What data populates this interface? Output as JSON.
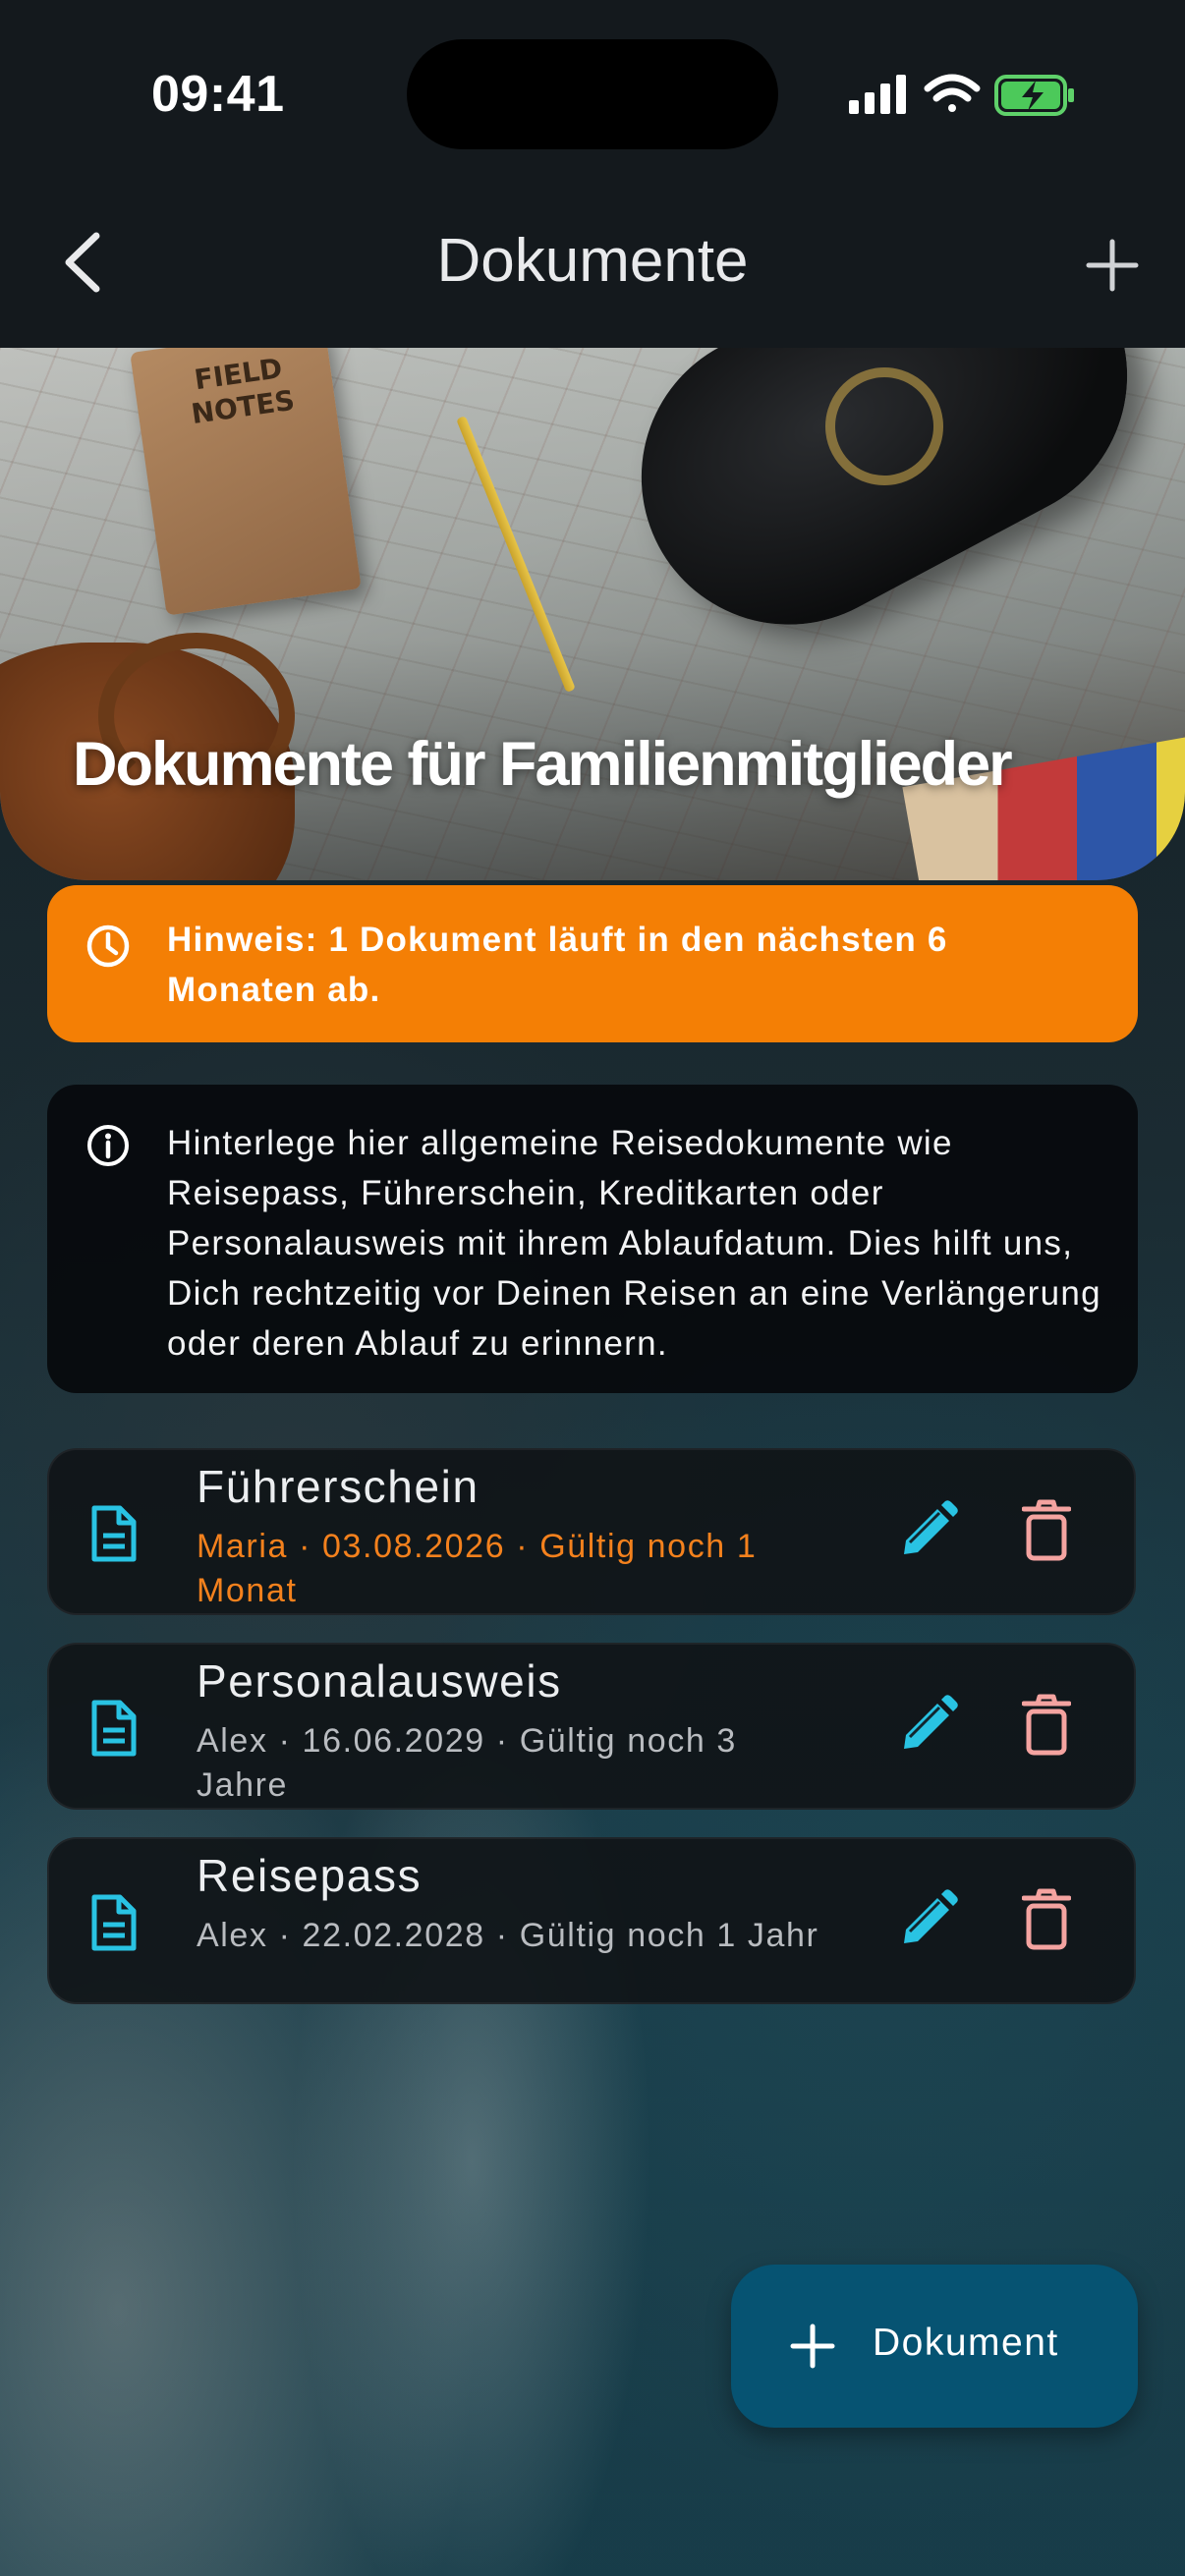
{
  "status_bar": {
    "time": "09:41"
  },
  "header": {
    "title": "Dokumente"
  },
  "hero": {
    "title": "Dokumente für Familienmitglieder",
    "notebook_text": "FIELD NOTES"
  },
  "warning_banner": {
    "icon": "clock-icon",
    "text": "Hinweis: 1 Dokument läuft in den nächsten 6 Monaten ab."
  },
  "info_banner": {
    "icon": "info-icon",
    "text": "Hinterlege hier allgemeine Reisedokumente wie Reisepass, Führerschein, Kreditkarten oder Personalausweis mit ihrem Ablaufdatum. Dies hilft uns, Dich rechtzeitig vor Deinen Reisen an eine Verlängerung oder deren Ablauf zu erinnern."
  },
  "documents": [
    {
      "name": "Führerschein",
      "meta": "Maria · 03.08.2026 · Gültig noch 1 Monat",
      "expiring": true
    },
    {
      "name": "Personalausweis",
      "meta": "Alex · 16.06.2029 · Gültig noch 3 Jahre",
      "expiring": false
    },
    {
      "name": "Reisepass",
      "meta": "Alex · 22.02.2028 · Gültig noch 1 Jahr",
      "expiring": false
    }
  ],
  "fab": {
    "label": "Dokument"
  },
  "colors": {
    "accent_cyan": "#29c3e3",
    "warning_orange": "#f47f05",
    "delete_pink": "#f4a3a0",
    "fab_blue": "#065372"
  }
}
